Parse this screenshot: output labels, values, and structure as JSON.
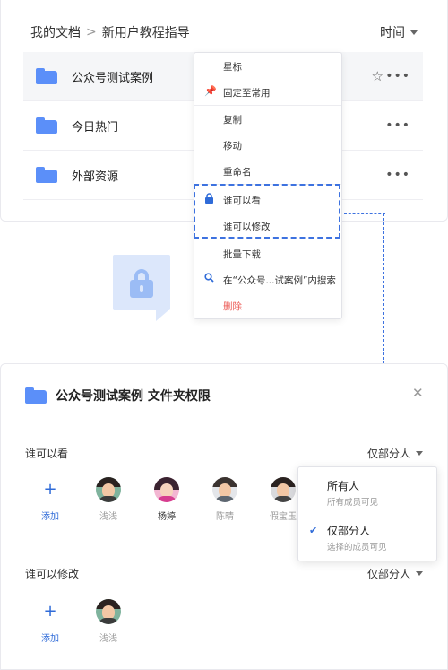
{
  "breadcrumb": {
    "root": "我的文档",
    "separator": ">",
    "current": "新用户教程指导"
  },
  "sort": {
    "label": "时间"
  },
  "files": [
    {
      "name": "公众号测试案例",
      "highlighted": true,
      "starred": false
    },
    {
      "name": "今日热门"
    },
    {
      "name": "外部资源"
    }
  ],
  "menu": {
    "items": [
      {
        "label": "星标"
      },
      {
        "label": "固定至常用",
        "icon": "pin-icon"
      },
      {
        "label": "复制"
      },
      {
        "label": "移动"
      },
      {
        "label": "重命名"
      },
      {
        "label": "谁可以看",
        "icon": "lock-icon"
      },
      {
        "label": "谁可以修改"
      },
      {
        "label": "批量下载"
      },
      {
        "label": "在“公众号...试案例”内搜索",
        "icon": "search-icon"
      },
      {
        "label": "删除",
        "color": "#ec5b56"
      }
    ]
  },
  "dialog": {
    "title": "公众号测试案例 文件夹权限",
    "view": {
      "label": "谁可以看",
      "scope": "仅部分人",
      "add_label": "添加",
      "people": [
        "浅浅",
        "杨婷",
        "陈晴",
        "假宝玉"
      ]
    },
    "edit": {
      "label": "谁可以修改",
      "scope": "仅部分人",
      "add_label": "添加",
      "people": [
        "浅浅"
      ]
    }
  },
  "scope_dropdown": {
    "options": [
      {
        "title": "所有人",
        "subtitle": "所有成员可见",
        "selected": false
      },
      {
        "title": "仅部分人",
        "subtitle": "选择的成员可见",
        "selected": true
      }
    ]
  },
  "colors": {
    "accent": "#3d72e0",
    "folder": "#5b8ff9",
    "danger": "#ec5b56",
    "lock_bubble": "#dce7fb"
  }
}
